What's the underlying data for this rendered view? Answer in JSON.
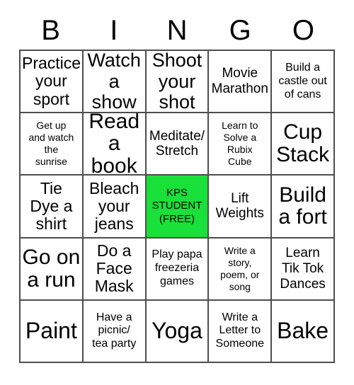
{
  "header": {
    "letters": [
      "B",
      "I",
      "N",
      "G",
      "O"
    ]
  },
  "grid": {
    "columns": 5,
    "rows": 5,
    "free_space_color": "#1ae03a",
    "border_color": "#4d4d4d",
    "background_color": "#ffffff",
    "text_color": "#000000",
    "cells": [
      {
        "text": "Practice\nyour\nsport",
        "size": "fs-md",
        "free": false
      },
      {
        "text": "Watch\na show",
        "size": "fs-lg",
        "free": false
      },
      {
        "text": "Shoot\nyour\nshot",
        "size": "fs-lg",
        "free": false
      },
      {
        "text": "Movie\nMarathon",
        "size": "fs-sm",
        "free": false
      },
      {
        "text": "Build a\ncastle out\nof cans",
        "size": "fs-xs",
        "free": false
      },
      {
        "text": "Get up\nand watch\nthe\nsunrise",
        "size": "fs-xxs",
        "free": false
      },
      {
        "text": "Read\na book",
        "size": "fs-xl",
        "free": false
      },
      {
        "text": "Meditate/\nStretch",
        "size": "fs-sm",
        "free": false
      },
      {
        "text": "Learn to\nSolve a\nRubix\nCube",
        "size": "fs-xxs",
        "free": false
      },
      {
        "text": "Cup\nStack",
        "size": "fs-xl",
        "free": false
      },
      {
        "text": "Tie\nDye a\nshirt",
        "size": "fs-md",
        "free": false
      },
      {
        "text": "Bleach\nyour\njeans",
        "size": "fs-md",
        "free": false
      },
      {
        "text": "KPS\nSTUDENT\n(FREE)",
        "size": "fs-free",
        "free": true
      },
      {
        "text": "Lift\nWeights",
        "size": "fs-sm",
        "free": false
      },
      {
        "text": "Build\na fort",
        "size": "fs-xl",
        "free": false
      },
      {
        "text": "Go on\na run",
        "size": "fs-xl",
        "free": false
      },
      {
        "text": "Do a\nFace\nMask",
        "size": "fs-md",
        "free": false
      },
      {
        "text": "Play papa\nfreezeria\ngames",
        "size": "fs-xs",
        "free": false
      },
      {
        "text": "Write a\nstory,\npoem, or\nsong",
        "size": "fs-xxs",
        "free": false
      },
      {
        "text": "Learn\nTik Tok\nDances",
        "size": "fs-sm",
        "free": false
      },
      {
        "text": "Paint",
        "size": "fs-xxl",
        "free": false
      },
      {
        "text": "Have a\npicnic/\ntea party",
        "size": "fs-xs",
        "free": false
      },
      {
        "text": "Yoga",
        "size": "fs-xxl",
        "free": false
      },
      {
        "text": "Write a\nLetter to\nSomeone",
        "size": "fs-xs",
        "free": false
      },
      {
        "text": "Bake",
        "size": "fs-xxl",
        "free": false
      }
    ]
  }
}
